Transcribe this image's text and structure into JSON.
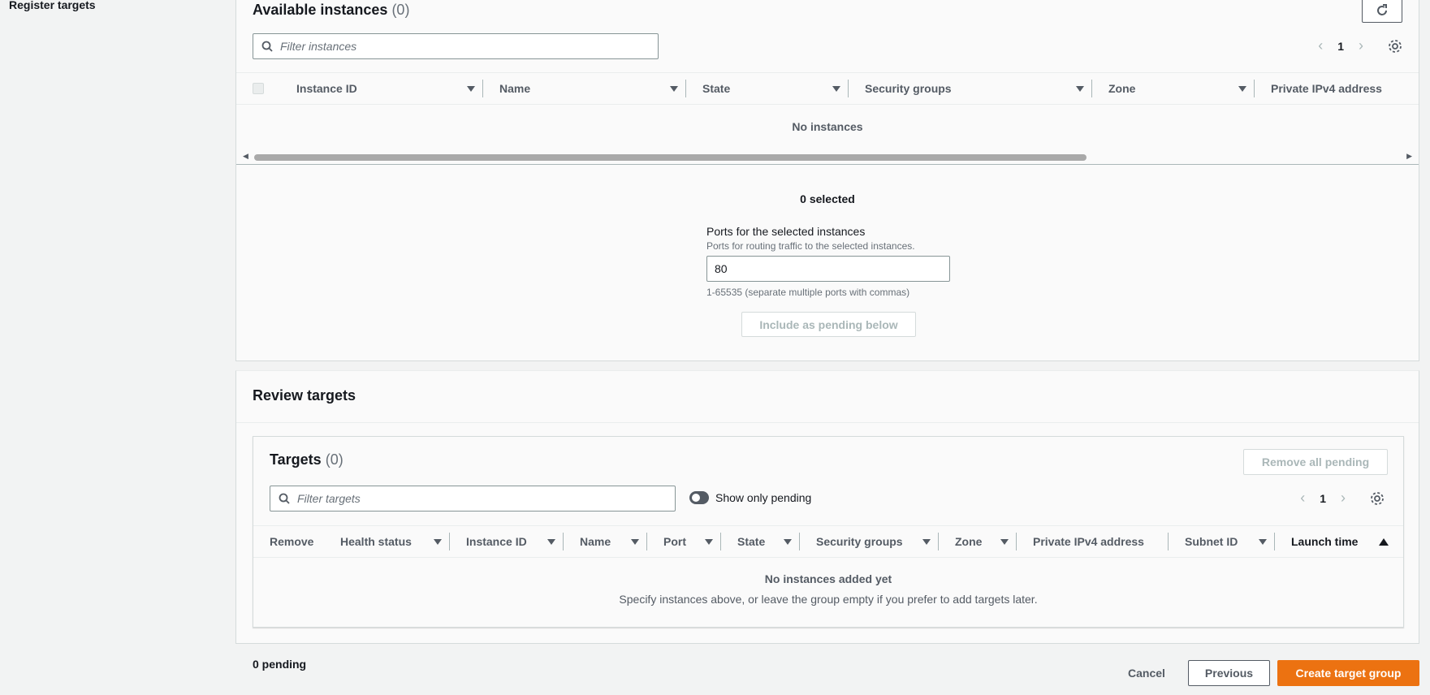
{
  "sidebar": {
    "step_label": "Register targets"
  },
  "available": {
    "title": "Available instances",
    "count": "(0)",
    "search_placeholder": "Filter instances",
    "page": "1",
    "columns": [
      "Instance ID",
      "Name",
      "State",
      "Security groups",
      "Zone",
      "Private IPv4 address"
    ],
    "empty_text": "No instances",
    "selected_text": "0 selected",
    "ports_label": "Ports for the selected instances",
    "ports_desc": "Ports for routing traffic to the selected instances.",
    "ports_value": "80",
    "ports_hint": "1-65535 (separate multiple ports with commas)",
    "include_button": "Include as pending below"
  },
  "review": {
    "title": "Review targets",
    "targets_title": "Targets",
    "targets_count": "(0)",
    "remove_all_button": "Remove all pending",
    "search_placeholder": "Filter targets",
    "toggle_label": "Show only pending",
    "page": "1",
    "columns": [
      "Remove",
      "Health status",
      "Instance ID",
      "Name",
      "Port",
      "State",
      "Security groups",
      "Zone",
      "Private IPv4 address",
      "Subnet ID",
      "Launch time"
    ],
    "empty_title": "No instances added yet",
    "empty_desc": "Specify instances above, or leave the group empty if you prefer to add targets later."
  },
  "footer": {
    "pending_text": "0 pending",
    "cancel": "Cancel",
    "previous": "Previous",
    "create": "Create target group"
  }
}
